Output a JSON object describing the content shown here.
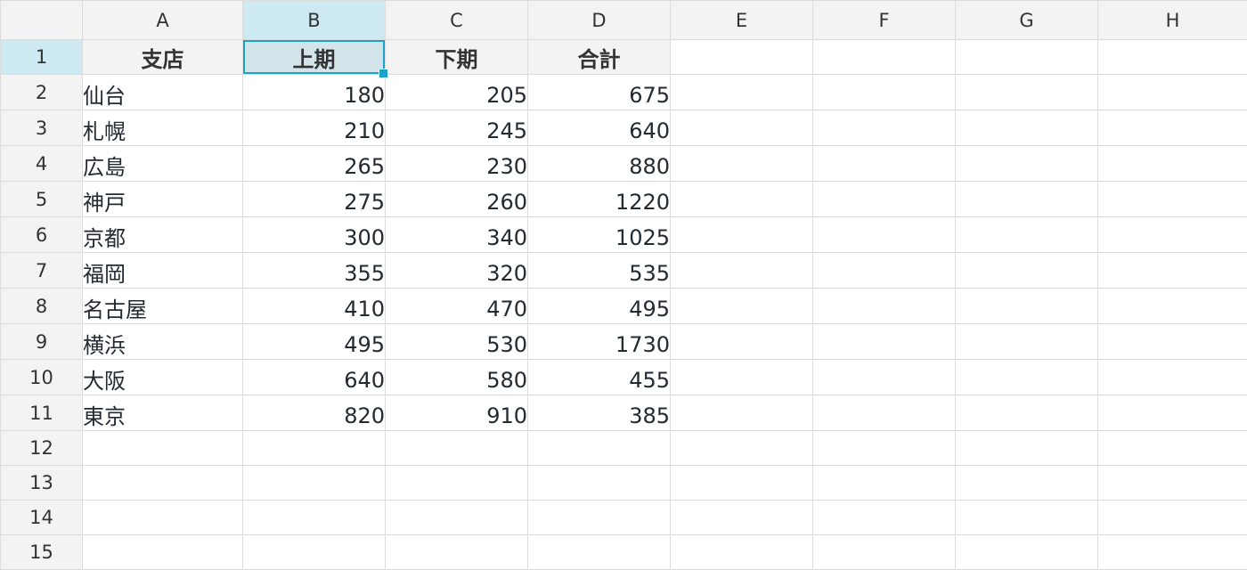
{
  "columns": {
    "A": "A",
    "B": "B",
    "C": "C",
    "D": "D",
    "E": "E",
    "F": "F",
    "G": "G",
    "H": "H"
  },
  "row_numbers": [
    "1",
    "2",
    "3",
    "4",
    "5",
    "6",
    "7",
    "8",
    "9",
    "10",
    "11",
    "12",
    "13",
    "14",
    "15"
  ],
  "active_cell": "B1",
  "colors": {
    "selection_border": "#1aa3c9",
    "header_selected_bg": "#cde9f2",
    "header_bg": "#f3f3f3"
  },
  "header_row": {
    "A": "支店",
    "B": "上期",
    "C": "下期",
    "D": "合計"
  },
  "rows": [
    {
      "A": "仙台",
      "B": "180",
      "C": "205",
      "D": "675"
    },
    {
      "A": "札幌",
      "B": "210",
      "C": "245",
      "D": "640"
    },
    {
      "A": "広島",
      "B": "265",
      "C": "230",
      "D": "880"
    },
    {
      "A": "神戸",
      "B": "275",
      "C": "260",
      "D": "1220"
    },
    {
      "A": "京都",
      "B": "300",
      "C": "340",
      "D": "1025"
    },
    {
      "A": "福岡",
      "B": "355",
      "C": "320",
      "D": "535"
    },
    {
      "A": "名古屋",
      "B": "410",
      "C": "470",
      "D": "495"
    },
    {
      "A": "横浜",
      "B": "495",
      "C": "530",
      "D": "1730"
    },
    {
      "A": "大阪",
      "B": "640",
      "C": "580",
      "D": "455"
    },
    {
      "A": "東京",
      "B": "820",
      "C": "910",
      "D": "385"
    }
  ]
}
